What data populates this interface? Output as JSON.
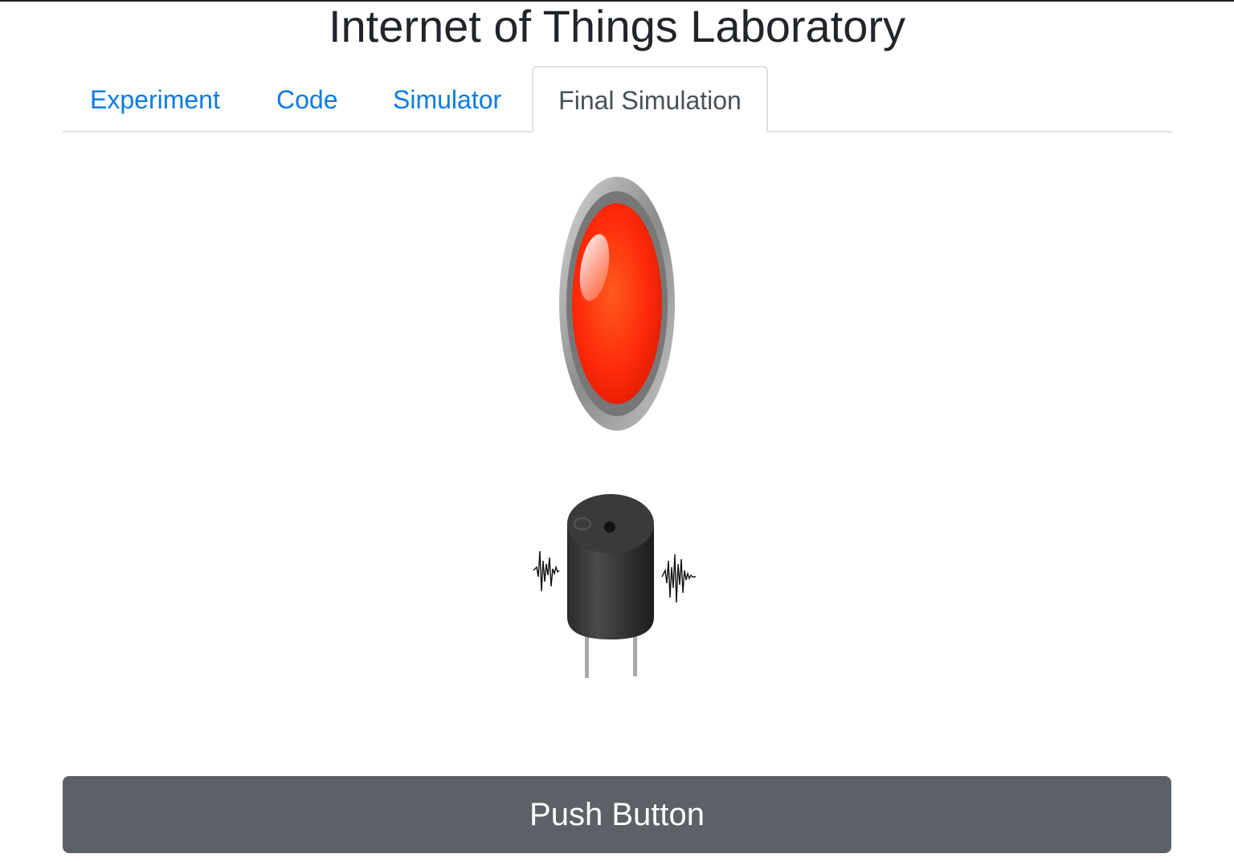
{
  "page": {
    "title": "Internet of Things Laboratory"
  },
  "tabs": {
    "items": [
      {
        "label": "Experiment"
      },
      {
        "label": "Code"
      },
      {
        "label": "Simulator"
      },
      {
        "label": "Final Simulation"
      }
    ],
    "active": "Final Simulation"
  },
  "simulation": {
    "led_color": "#ff2a0a",
    "led_state": "on",
    "buzzer_state": "sounding"
  },
  "actions": {
    "push_button_label": "Push Button"
  },
  "colors": {
    "link": "#0d7be6",
    "active_tab_text": "#495057",
    "button_bg": "#5b6166",
    "button_text": "#ffffff"
  }
}
